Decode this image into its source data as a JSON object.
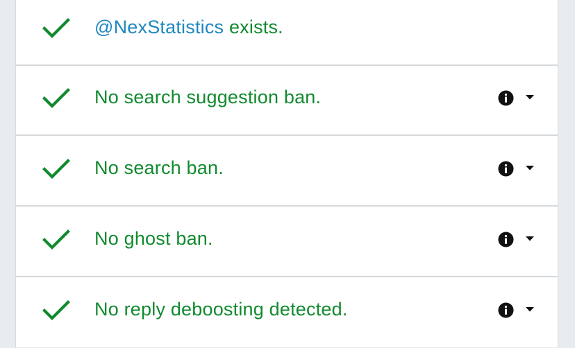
{
  "colors": {
    "success": "#118a2e",
    "handle": "#1f87bf",
    "icon": "#111111"
  },
  "rows": [
    {
      "icon": "check-icon",
      "handle": "@NexStatistics",
      "text": " exists.",
      "has_info": false
    },
    {
      "icon": "check-icon",
      "text": "No search suggestion ban.",
      "has_info": true
    },
    {
      "icon": "check-icon",
      "text": "No search ban.",
      "has_info": true
    },
    {
      "icon": "check-icon",
      "text": "No ghost ban.",
      "has_info": true
    },
    {
      "icon": "check-icon",
      "text": "No reply deboosting detected.",
      "has_info": true
    }
  ]
}
